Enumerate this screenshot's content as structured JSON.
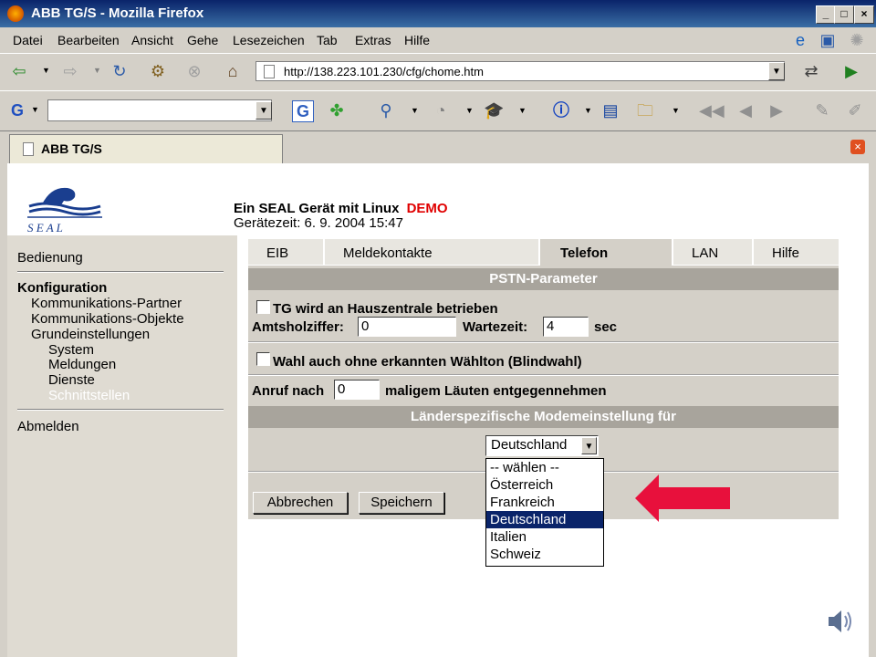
{
  "window": {
    "title": "ABB TG/S - Mozilla Firefox"
  },
  "menu": [
    "Datei",
    "Bearbeiten",
    "Ansicht",
    "Gehe",
    "Lesezeichen",
    "Tab",
    "Extras",
    "Hilfe"
  ],
  "address": {
    "url": "http://138.223.101.230/cfg/chome.htm"
  },
  "tab": {
    "label": "ABB TG/S"
  },
  "header": {
    "line1": "Ein SEAL Gerät mit Linux",
    "demo": "DEMO",
    "time": "Gerätezeit: 6. 9. 2004  15:47",
    "logo_text": "S E A L"
  },
  "sidebar": {
    "bedienung": "Bedienung",
    "konfiguration": "Konfiguration",
    "items": [
      "Kommunikations-Partner",
      "Kommunikations-Objekte",
      "Grundeinstellungen"
    ],
    "subitems": [
      "System",
      "Meldungen",
      "Dienste",
      "Schnittstellen"
    ],
    "abmelden": "Abmelden"
  },
  "tabs": [
    "EIB",
    "Meldekontakte",
    "Telefon",
    "LAN",
    "Hilfe"
  ],
  "panel": {
    "pstn_header": "PSTN-Parameter",
    "tg_label": "TG wird an Hauszentrale betrieben",
    "amtsholziffer_label": "Amtsholziffer:",
    "amtsholziffer_value": "0",
    "wartezeit_label": "Wartezeit:",
    "wartezeit_value": "4",
    "sec": "sec",
    "blindwahl_label": "Wahl auch ohne erkannten Wählton (Blindwahl)",
    "anruf_label": "Anruf nach",
    "anruf_value": "0",
    "anruf_suffix": "maligem Läuten entgegennehmen",
    "laender_header": "Länderspezifische Modemeinstellung für",
    "country_selected": "Deutschland",
    "country_options": [
      "-- wählen --",
      "Österreich",
      "Frankreich",
      "Deutschland",
      "Italien",
      "Schweiz"
    ],
    "cancel": "Abbrechen",
    "save": "Speichern"
  },
  "colors": {
    "demo": "#e00000",
    "arrow": "#e8103c",
    "selected": "#0a246a",
    "inactive_link": "#ffffff"
  }
}
